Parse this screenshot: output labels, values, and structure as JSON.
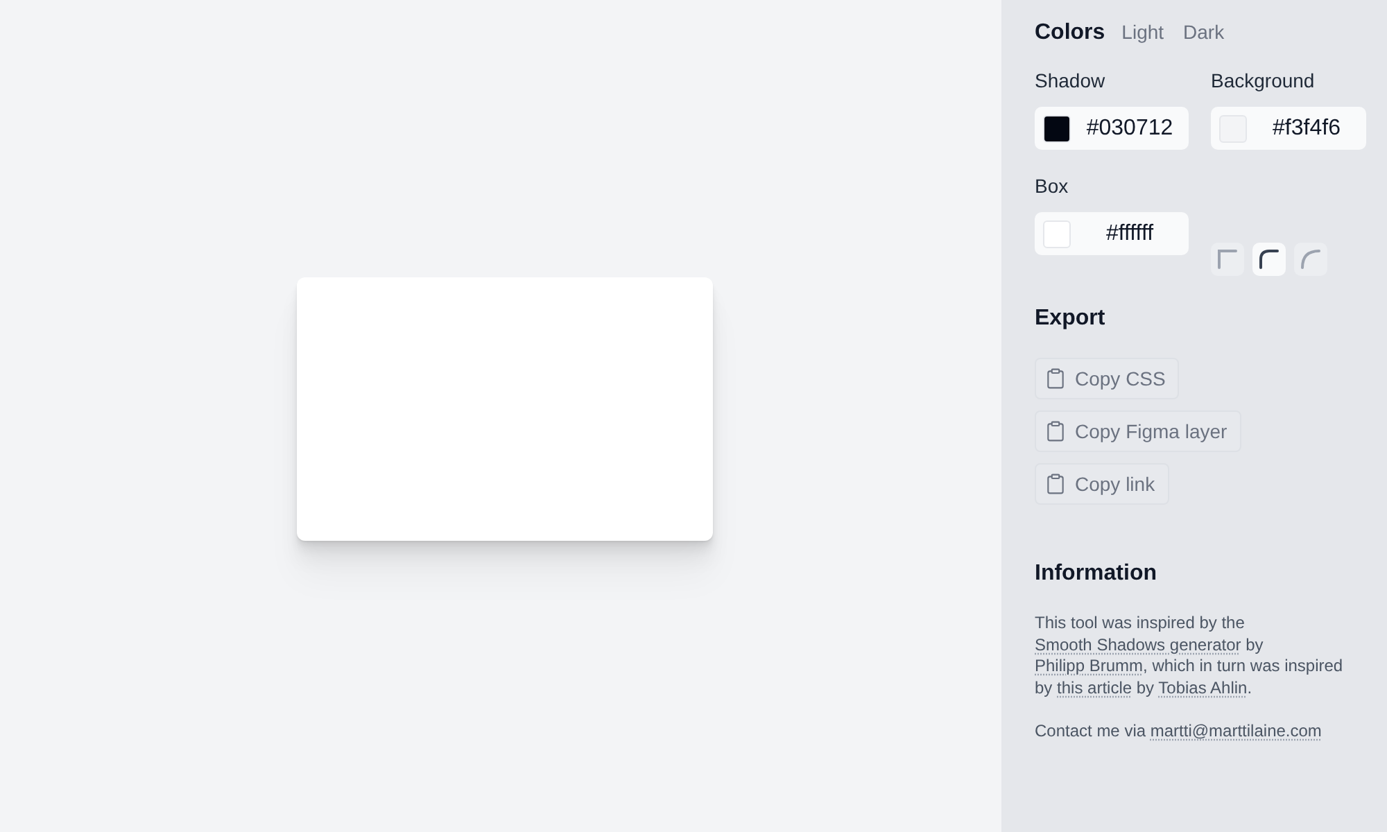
{
  "colors": {
    "title": "Colors",
    "presets": [
      "Light",
      "Dark"
    ],
    "fields": [
      {
        "kind": "shadow",
        "label": "Shadow",
        "value": "#030712",
        "color": "#030712"
      },
      {
        "kind": "background",
        "label": "Background",
        "value": "#f3f4f6",
        "color": "#f3f4f6"
      },
      {
        "kind": "box",
        "label": "Box",
        "value": "#ffffff",
        "color": "#ffffff"
      }
    ],
    "corners": [
      {
        "kind": "square",
        "selected": false
      },
      {
        "kind": "rounded",
        "selected": true
      },
      {
        "kind": "round",
        "selected": false
      }
    ]
  },
  "export": {
    "title": "Export",
    "buttons": [
      "Copy CSS",
      "Copy Figma layer",
      "Copy link"
    ]
  },
  "information": {
    "title": "Information",
    "paragraphs": [
      [
        {
          "kind": "text",
          "text": "This tool was inspired by the "
        },
        {
          "kind": "link",
          "text": "Smooth Shadows generator"
        },
        {
          "kind": "text",
          "text": " by "
        },
        {
          "kind": "link",
          "text": "Philipp Brumm"
        },
        {
          "kind": "text",
          "text": ", which in turn was inspired by "
        },
        {
          "kind": "link",
          "text": "this article"
        },
        {
          "kind": "text",
          "text": " by "
        },
        {
          "kind": "link",
          "text": "Tobias Ahlin"
        },
        {
          "kind": "text",
          "text": "."
        }
      ],
      [
        {
          "kind": "text",
          "text": "Contact me via "
        },
        {
          "kind": "link",
          "text": "martti@marttilaine.com"
        }
      ]
    ]
  }
}
